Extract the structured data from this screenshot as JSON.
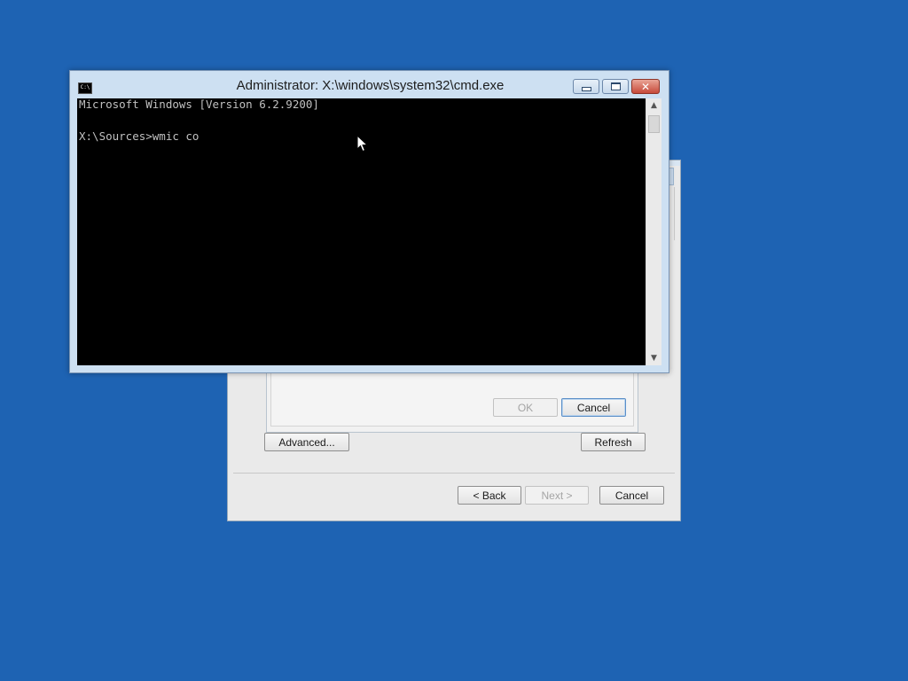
{
  "desktop": {
    "background_color": "#1e63b3"
  },
  "wizard": {
    "advanced_label": "Advanced...",
    "refresh_label": "Refresh",
    "back_label": "< Back",
    "next_label": "Next >",
    "cancel_label": "Cancel"
  },
  "inner_dialog": {
    "ok_label": "OK",
    "cancel_label": "Cancel"
  },
  "cmd": {
    "title": "Administrator: X:\\windows\\system32\\cmd.exe",
    "icon_text": "C:\\",
    "lines": [
      "Microsoft Windows [Version 6.2.9200]",
      "",
      "X:\\Sources>wmic co"
    ],
    "scroll_up_glyph": "▲",
    "scroll_down_glyph": "▼",
    "close_glyph": "✕"
  },
  "icons": {
    "app": "console-icon",
    "minimize": "minimize-icon",
    "maximize": "maximize-icon",
    "close": "close-icon",
    "cursor": "mouse-pointer-icon"
  }
}
